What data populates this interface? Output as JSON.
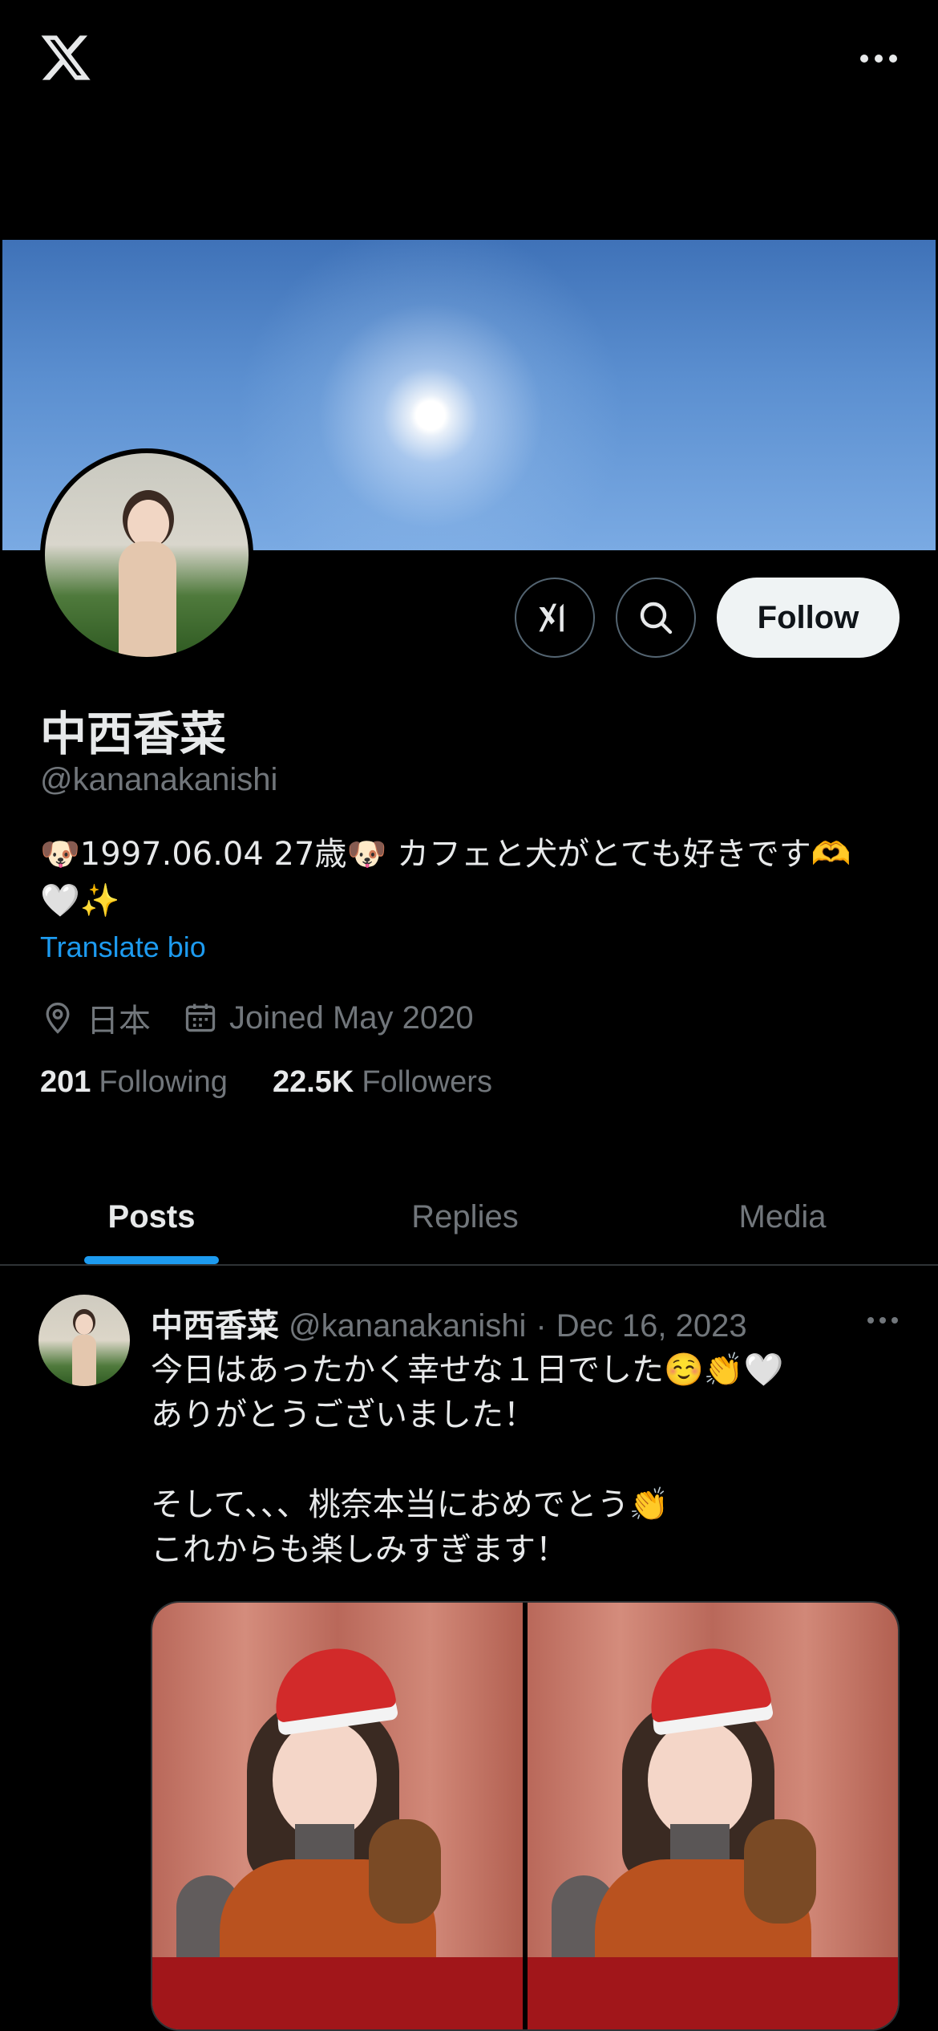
{
  "topbar": {
    "logo_icon": "x-logo-icon",
    "more_icon": "more-horizontal-icon"
  },
  "profile": {
    "display_name": "中西香菜",
    "handle": "@kananakanishi",
    "bio": "🐶1997.06.04 27歳🐶 カフェと犬がとても好きです🫶\n🤍✨",
    "translate_label": "Translate bio",
    "location": "日本",
    "joined": "Joined May 2020",
    "following_count": "201",
    "following_label": "Following",
    "followers_count": "22.5K",
    "followers_label": "Followers"
  },
  "actions": {
    "grok_icon": "grok-icon",
    "search_icon": "search-icon",
    "follow_label": "Follow"
  },
  "tabs": [
    {
      "label": "Posts",
      "active": true
    },
    {
      "label": "Replies",
      "active": false
    },
    {
      "label": "Media",
      "active": false
    }
  ],
  "post": {
    "author_name": "中西香菜",
    "author_handle": "@kananakanishi",
    "separator": "·",
    "date": "Dec 16, 2023",
    "text": "今日はあったかく幸せな１日でした☺️👏🤍\nありがとうございました！\n\nそして、、、桃奈本当におめでとう👏\nこれからも楽しみすぎます！"
  },
  "colors": {
    "background": "#000000",
    "text_primary": "#e7e9ea",
    "text_secondary": "#71767b",
    "accent": "#1d9bf0",
    "follow_button_bg": "#eff3f4",
    "border": "#2f3336"
  }
}
